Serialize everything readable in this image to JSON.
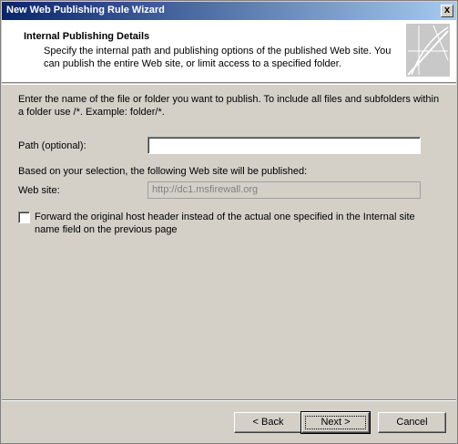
{
  "window": {
    "title": "New Web Publishing Rule Wizard",
    "close_glyph": "x"
  },
  "header": {
    "title": "Internal Publishing Details",
    "description": "Specify the internal path and publishing options of the published Web site. You can publish the entire Web site, or limit access to a specified folder.",
    "logo_icon": "wizard-logo-icon"
  },
  "body": {
    "intro": "Enter the name of the file or folder you want to publish. To include all files and subfolders within a folder use /*. Example: folder/*.",
    "path_label": "Path (optional):",
    "path_value": "",
    "based_on_label": "Based on your selection, the following Web site will be published:",
    "web_site_label": "Web site:",
    "web_site_value": "http://dc1.msfirewall.org",
    "forward_checkbox_label": "Forward the original host header instead of the actual one specified in the Internal site name field on the previous page",
    "forward_checked": false
  },
  "buttons": {
    "back": "< Back",
    "next": "Next >",
    "cancel": "Cancel"
  }
}
